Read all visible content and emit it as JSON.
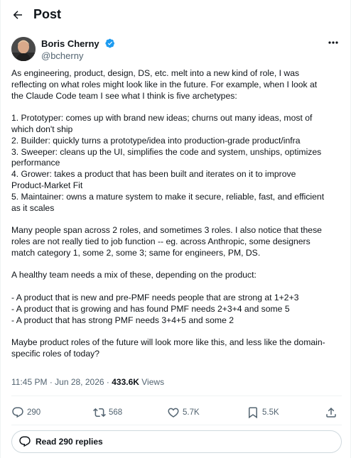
{
  "header": {
    "title": "Post"
  },
  "author": {
    "name": "Boris Cherny",
    "handle": "@bcherny",
    "verified_color": "#1d9bf0"
  },
  "post": {
    "lines": [
      "As engineering, product, design, DS, etc. melt into a new kind of role, I was",
      "reflecting on what roles might look like in the future. For example, when I look at",
      "the Claude Code team I see what I think is five archetypes:",
      "",
      "1. Prototyper: comes up with brand new ideas; churns out many ideas, most of",
      "which don't ship",
      "2. Builder: quickly turns a prototype/idea into production-grade product/infra",
      "3. Sweeper: cleans up the UI, simplifies the code and system, unships, optimizes",
      "performance",
      "4. Grower: takes a product that has been built and iterates on it to improve",
      "Product-Market Fit",
      "5. Maintainer: owns a mature system to make it secure, reliable, fast, and efficient",
      "as it scales",
      "",
      "Many people span across 2 roles, and sometimes 3 roles. I also notice that these",
      "roles are not really tied to job function -- eg. across Anthropic, some designers",
      "match category 1, some 2, some 3; same for engineers, PM, DS.",
      "",
      "A healthy team needs a mix of these, depending on the product:",
      "",
      "- A product that is new and pre-PMF needs people that are strong at 1+2+3",
      "- A product that is growing and has found PMF needs 2+3+4 and some 5",
      "- A product that has strong PMF needs 3+4+5 and some 2",
      "",
      "Maybe product roles of the future will look more like this, and less like the domain-",
      "specific roles of today?"
    ]
  },
  "meta": {
    "time": "11:45 PM",
    "sep1": " · ",
    "date": "Jun 28, 2026",
    "sep2": " · ",
    "views_count": "433.6K",
    "views_label": " Views"
  },
  "actions": {
    "replies": "290",
    "reposts": "568",
    "likes": "5.7K",
    "bookmarks": "5.5K"
  },
  "read_replies": {
    "label": "Read 290 replies"
  }
}
